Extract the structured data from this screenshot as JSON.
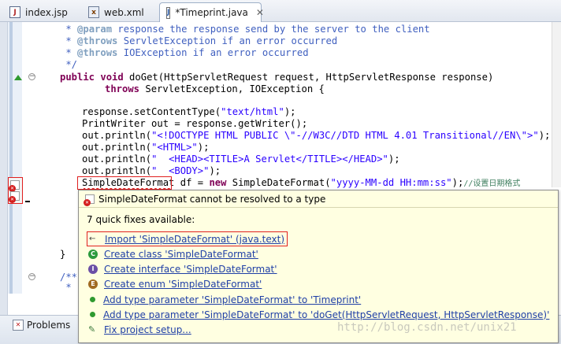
{
  "tabs": [
    {
      "label": "index.jsp",
      "icon": "jsp-file-icon",
      "active": false
    },
    {
      "label": "web.xml",
      "icon": "xml-file-icon",
      "active": false
    },
    {
      "label": "*Timeprint.java",
      "icon": "java-file-icon",
      "active": true,
      "close": "✕"
    }
  ],
  "editor": {
    "lines": {
      "l1a": " * ",
      "l1tag": "@param",
      "l1b": " response the response send by the server to the client",
      "l2a": " * ",
      "l2tag": "@throws",
      "l2b": " ServletException if an error occurred",
      "l3a": " * ",
      "l3tag": "@throws",
      "l3b": " IOException if an error occurred",
      "l4": " */",
      "l5kw": "public void",
      "l5": " doGet(HttpServletRequest request, HttpServletResponse response)",
      "l6kw": "throws",
      "l6": " ServletException, IOException {",
      "l7a": "response.setContentType(",
      "l7s": "\"text/html\"",
      "l7b": ");",
      "l8": "PrintWriter out = response.getWriter();",
      "l9a": "out.println(",
      "l9s": "\"<!DOCTYPE HTML PUBLIC \\\"-//W3C//DTD HTML 4.01 Transitional//EN\\\">\"",
      "l9b": ");",
      "l10a": "out.println(",
      "l10s": "\"<HTML>\"",
      "l10b": ");",
      "l11a": "out.println(",
      "l11s": "\"  <HEAD><TITLE>A Servlet</TITLE></HEAD>\"",
      "l11b": ");",
      "l12a": "out.println(",
      "l12s": "\"  <BODY>\"",
      "l12b": ");",
      "l13a": "SimpleDateFormat",
      "l13b": " df = ",
      "l13kw": "new",
      "l13c": " SimpleDateFormat(",
      "l13s": "\"yyyy-MM-dd HH:mm:ss\"",
      "l13d": ");",
      "l13cmt": "//设置日期格式",
      "l14": "}",
      "l15": "/**",
      "l16": " *"
    }
  },
  "quickfix": {
    "title": "SimpleDateFormat cannot be resolved to a type",
    "count_text": "7 quick fixes available:",
    "fixes": [
      {
        "label": "Import 'SimpleDateFormat' (java.text)",
        "icon": "import-icon"
      },
      {
        "label": "Create class 'SimpleDateFormat'",
        "icon": "class-icon"
      },
      {
        "label": "Create interface 'SimpleDateFormat'",
        "icon": "interface-icon"
      },
      {
        "label": "Create enum 'SimpleDateFormat'",
        "icon": "enum-icon"
      },
      {
        "label": "Add type parameter 'SimpleDateFormat' to 'Timeprint'",
        "icon": "type-parameter-icon"
      },
      {
        "label": "Add type parameter 'SimpleDateFormat' to 'doGet(HttpServletRequest, HttpServletResponse)'",
        "icon": "type-parameter-icon"
      },
      {
        "label": "Fix project setup...",
        "icon": "wrench-icon"
      }
    ]
  },
  "bottom": {
    "problems_label": "Problems"
  },
  "watermark": "http://blog.csdn.net/unix21"
}
